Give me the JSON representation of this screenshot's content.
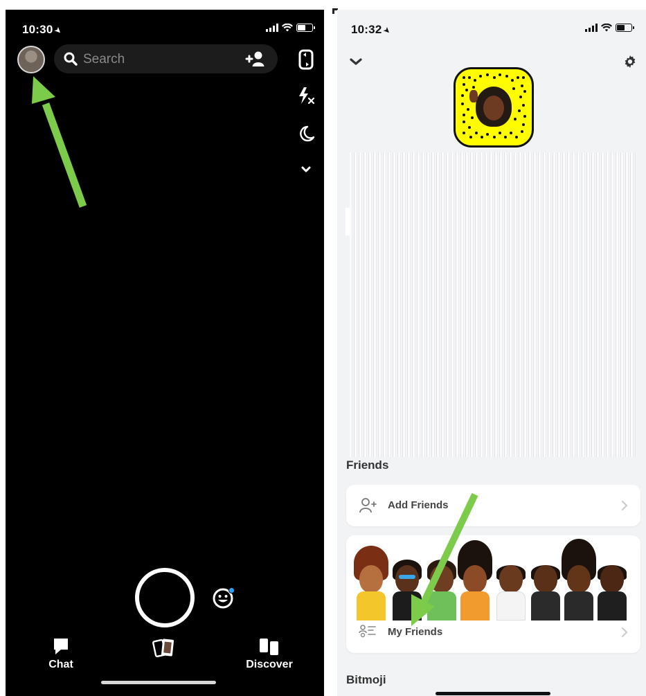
{
  "left_screen": {
    "status": {
      "time": "10:30"
    },
    "search": {
      "placeholder": "Search"
    },
    "nav": {
      "chat": "Chat",
      "discover": "Discover"
    },
    "icons": {
      "avatar": "profile-avatar",
      "search": "search-icon",
      "add_friend": "add-friend-icon",
      "flip_camera": "flip-camera-icon",
      "flash": "flash-off-icon",
      "night_mode": "moon-icon",
      "more": "chevron-down-icon",
      "lens": "lens-smiley-icon",
      "memories": "memories-icon"
    }
  },
  "right_screen": {
    "status": {
      "time": "10:32"
    },
    "sections": {
      "friends_title": "Friends",
      "bitmoji_title": "Bitmoji"
    },
    "friends": {
      "add_friends": "Add Friends",
      "my_friends": "My Friends"
    },
    "icons": {
      "back": "chevron-down-icon",
      "settings": "gear-icon",
      "snapcode": "snapcode-icon"
    }
  },
  "colors": {
    "annotation_arrow": "#7ccb4a",
    "snap_yellow": "#fffc00",
    "camera_bg": "#000000",
    "profile_bg": "#f2f3f5",
    "lens_dot": "#26a4ff"
  }
}
